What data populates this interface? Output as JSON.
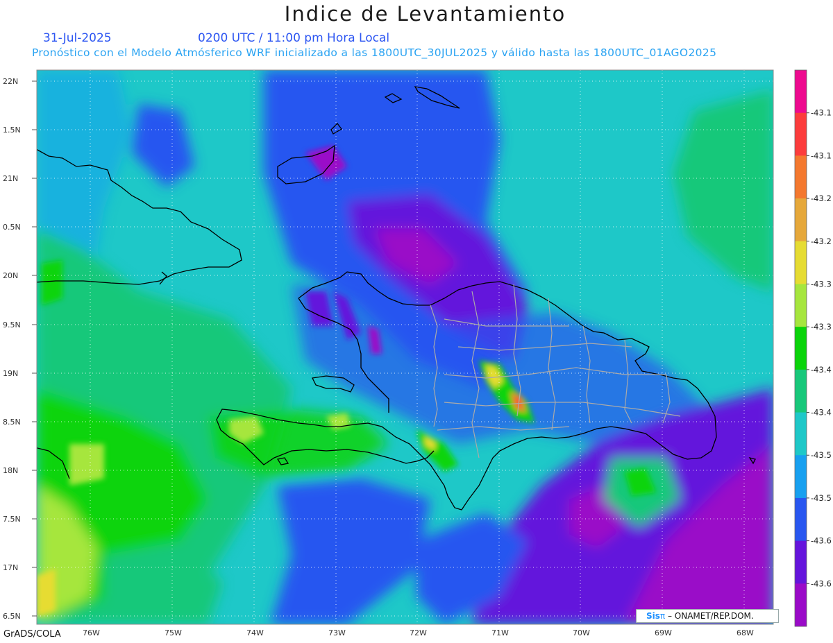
{
  "title": "Indice de Levantamiento",
  "date": "31-Jul-2025",
  "time_line": "0200 UTC / 11:00 pm Hora Local",
  "subtitle": "Pronóstico con el Modelo Atmósferico WRF inicializado a las 1800UTC_30JUL2025 y válido hasta las  1800UTC_01AGO2025",
  "latitude_labels": [
    "22N",
    "1.5N",
    "21N",
    "0.5N",
    "20N",
    "9.5N",
    "19N",
    "8.5N",
    "18N",
    "7.5N",
    "17N",
    "6.5N"
  ],
  "longitude_labels": [
    "76W",
    "75W",
    "74W",
    "73W",
    "72W",
    "71W",
    "70W",
    "69W",
    "68W"
  ],
  "colorbar": {
    "labels": [
      "-43.1",
      "-43.1",
      "-43.2",
      "-43.2",
      "-43.3",
      "-43.3",
      "-43.4",
      "-43.4",
      "-43.5",
      "-43.5",
      "-43.6",
      "-43.6"
    ],
    "colors": [
      "#ee0a8f",
      "#fc3c3c",
      "#f4782e",
      "#e6a83a",
      "#e6dc32",
      "#a6e63e",
      "#0ad40a",
      "#17c87a",
      "#1ec8c8",
      "#17a0f0",
      "#2856f0",
      "#6414dc",
      "#9a0ac8"
    ]
  },
  "credit": {
    "logo": "Sis",
    "logo_symbol": "π",
    "org": "– ONAMET/REP.DOM."
  },
  "software": "GrADS/COLA"
}
